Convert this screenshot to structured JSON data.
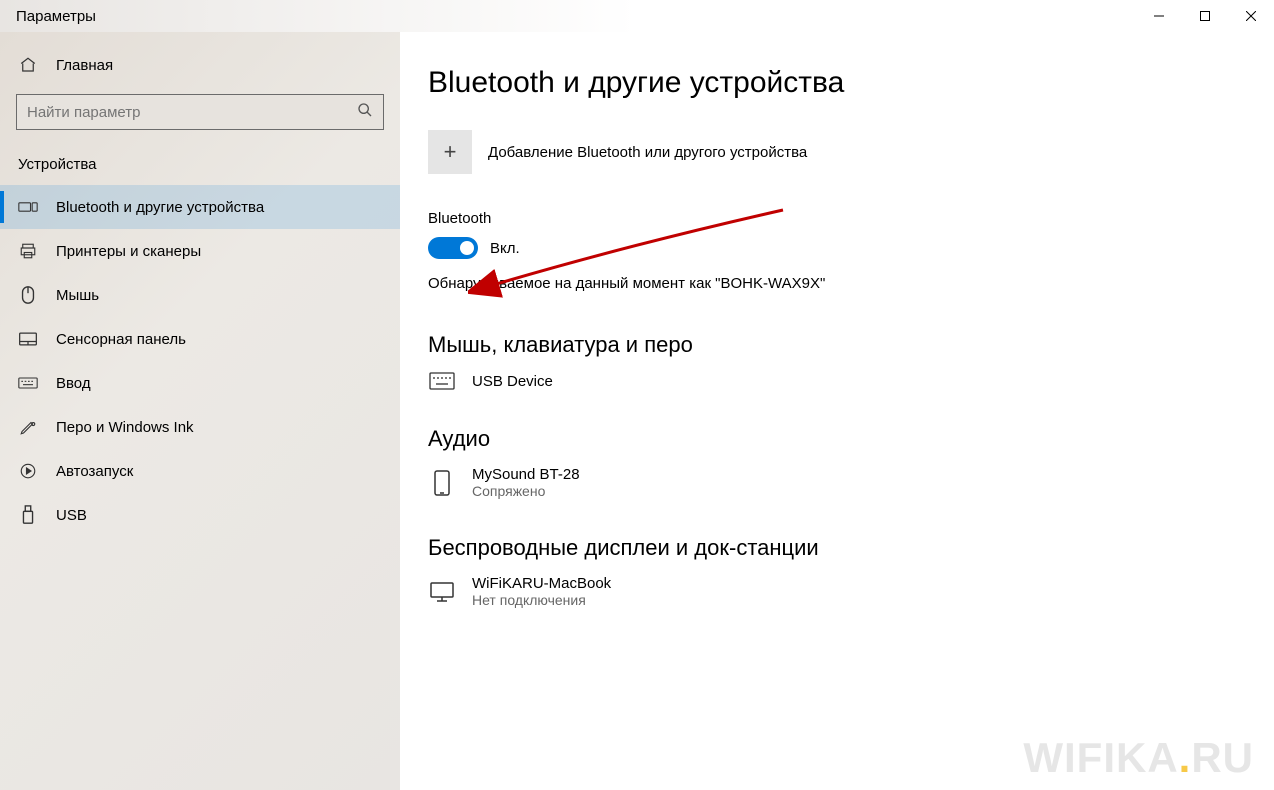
{
  "window": {
    "title": "Параметры"
  },
  "sidebar": {
    "home": "Главная",
    "search_placeholder": "Найти параметр",
    "section": "Устройства",
    "items": [
      {
        "label": "Bluetooth и другие устройства",
        "icon": "bluetooth-devices",
        "active": true
      },
      {
        "label": "Принтеры и сканеры",
        "icon": "printer",
        "active": false
      },
      {
        "label": "Мышь",
        "icon": "mouse",
        "active": false
      },
      {
        "label": "Сенсорная панель",
        "icon": "touchpad",
        "active": false
      },
      {
        "label": "Ввод",
        "icon": "keyboard",
        "active": false
      },
      {
        "label": "Перо и Windows Ink",
        "icon": "pen",
        "active": false
      },
      {
        "label": "Автозапуск",
        "icon": "autoplay",
        "active": false
      },
      {
        "label": "USB",
        "icon": "usb",
        "active": false
      }
    ]
  },
  "main": {
    "title": "Bluetooth и другие устройства",
    "add_device": "Добавление Bluetooth или другого устройства",
    "bt_label": "Bluetooth",
    "bt_state": "Вкл.",
    "discoverable": "Обнаруживаемое на данный момент как \"BOHK-WAX9X\"",
    "sections": [
      {
        "title": "Мышь, клавиатура и перо",
        "devices": [
          {
            "name": "USB Device",
            "sub": "",
            "icon": "keyboard"
          }
        ]
      },
      {
        "title": "Аудио",
        "devices": [
          {
            "name": "MySound BT-28",
            "sub": "Сопряжено",
            "icon": "phone"
          }
        ]
      },
      {
        "title": "Беспроводные дисплеи и док-станции",
        "devices": [
          {
            "name": "WiFiKARU-MacBook",
            "sub": "Нет подключения",
            "icon": "monitor"
          }
        ]
      }
    ]
  },
  "watermark": {
    "text": "WIFIKA",
    "suffix": "RU"
  }
}
